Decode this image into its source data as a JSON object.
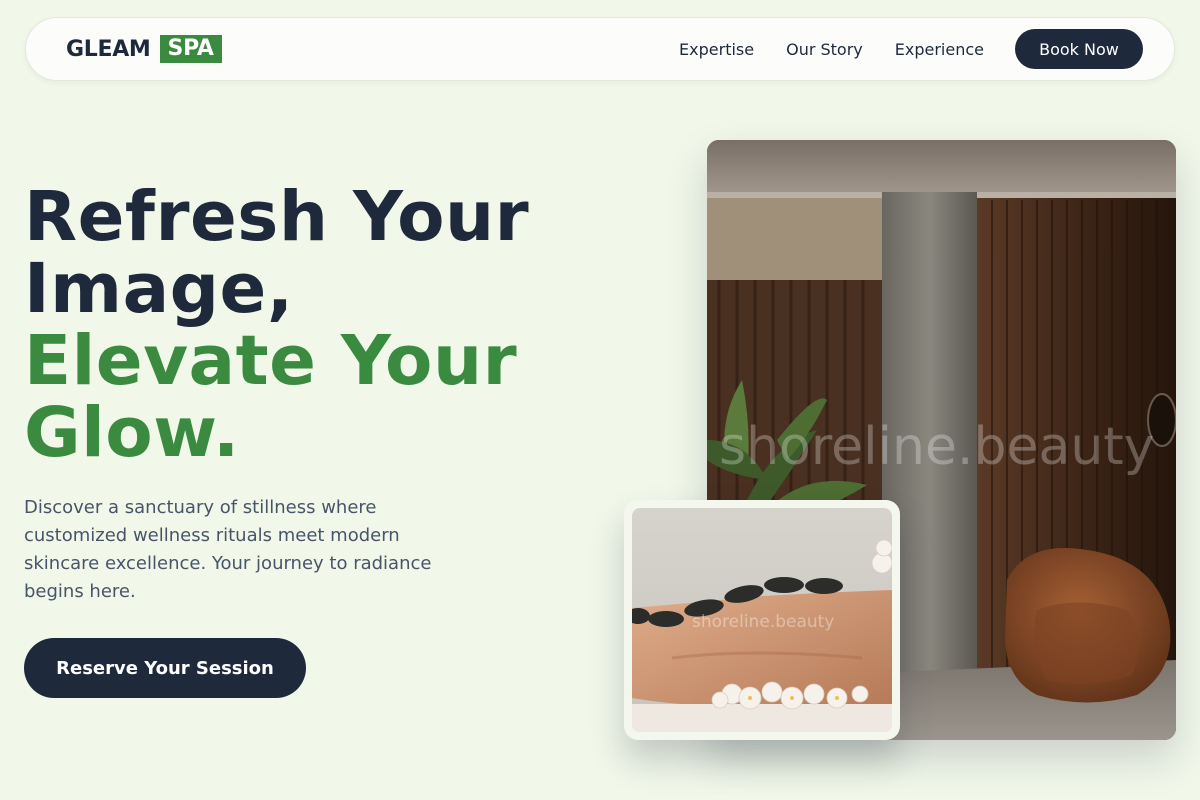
{
  "brand": {
    "name": "GLEAM",
    "badge": "SPA"
  },
  "nav": {
    "links": [
      "Expertise",
      "Our Story",
      "Experience"
    ],
    "cta_label": "Book Now"
  },
  "hero": {
    "headline_line1": "Refresh Your",
    "headline_line2": "Image,",
    "headline_line3": "Elevate Your",
    "headline_line4": "Glow.",
    "description": "Discover a sanctuary of stillness where customized wellness rituals meet modern skincare excellence. Your journey to radiance begins here.",
    "cta_label": "Reserve Your Session"
  },
  "images": {
    "main_watermark": "shoreline.beauty",
    "small_watermark": "shoreline.beauty"
  },
  "colors": {
    "background": "#f1f7e9",
    "navy": "#1e293b",
    "accent_green": "#3a8a40"
  }
}
